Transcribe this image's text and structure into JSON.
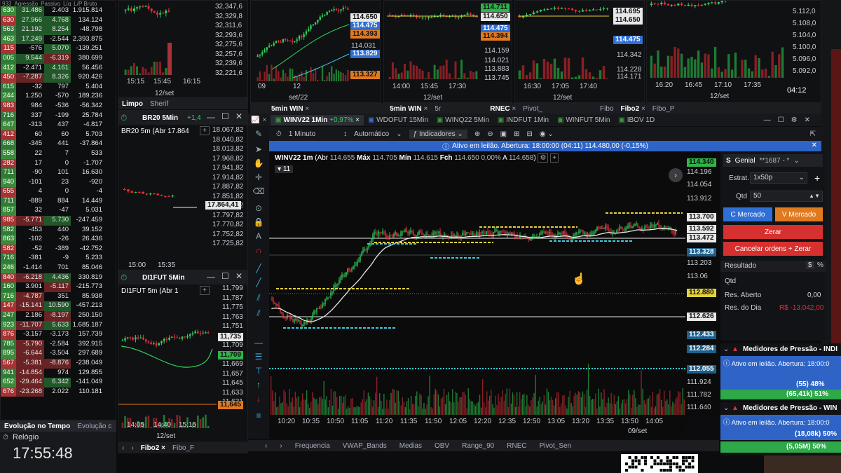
{
  "left_grid": {
    "header": [
      "933",
      "Agressão",
      "Passivo",
      "Líq",
      "L/P Bruto"
    ],
    "rows": [
      [
        "630",
        "31.486",
        "2.403",
        "1.915.814"
      ],
      [
        "630",
        "27.966",
        "4.768",
        "134.124"
      ],
      [
        "563",
        "21.192",
        "8.254",
        "-48.798"
      ],
      [
        "463",
        "17.249",
        "-2.544",
        "2.393.875"
      ],
      [
        "115",
        "-576",
        "5.070",
        "-139.251"
      ],
      [
        "005",
        "9.544",
        "-6.319",
        "380.699"
      ],
      [
        "412",
        "-2.471",
        "4.161",
        "56.456"
      ],
      [
        "450",
        "-7.287",
        "8.326",
        "920.426"
      ],
      [
        "615",
        "-32",
        "797",
        "5.404"
      ],
      [
        "244",
        "1.250",
        "-570",
        "189.236"
      ],
      [
        "983",
        "984",
        "-536",
        "-56.342"
      ],
      [
        "716",
        "337",
        "-199",
        "25.784"
      ],
      [
        "647",
        "-313",
        "437",
        "-4.817"
      ],
      [
        "412",
        "60",
        "60",
        "5.703"
      ],
      [
        "668",
        "-345",
        "441",
        "-37.864"
      ],
      [
        "558",
        "22",
        "7",
        "533"
      ],
      [
        "282",
        "17",
        "0",
        "-1.707"
      ],
      [
        "711",
        "-90",
        "101",
        "16.630"
      ],
      [
        "940",
        "-101",
        "23",
        "-920"
      ],
      [
        "655",
        "4",
        "0",
        "-4"
      ],
      [
        "711",
        "-889",
        "884",
        "14.449"
      ],
      [
        "857",
        "32",
        "-47",
        "5.031"
      ],
      [
        "985",
        "-5.771",
        "5.730",
        "-247.459"
      ],
      [
        "582",
        "-453",
        "440",
        "39.152"
      ],
      [
        "863",
        "-102",
        "-26",
        "26.436"
      ],
      [
        "582",
        "-52",
        "-389",
        "-42.752"
      ],
      [
        "716",
        "-381",
        "-9",
        "5.233"
      ],
      [
        "246",
        "-1.414",
        "701",
        "85.046"
      ],
      [
        "840",
        "-6.218",
        "4.436",
        "330.819"
      ],
      [
        "160",
        "3.901",
        "-5.117",
        "-215.773"
      ],
      [
        "716",
        "-4.787",
        "351",
        "85.938"
      ],
      [
        "147",
        "-15.141",
        "10.590",
        "-457.213"
      ],
      [
        "247",
        "2.186",
        "-8.197",
        "250.150"
      ],
      [
        "923",
        "-11.707",
        "5.633",
        "1.685.187"
      ],
      [
        "876",
        "-3.157",
        "-3.173",
        "157.739"
      ],
      [
        "785",
        "-5.790",
        "-2.584",
        "392.915"
      ],
      [
        "895",
        "-6.644",
        "-3.504",
        "297.689"
      ],
      [
        "567",
        "-5.381",
        "-8.876",
        "-238.049"
      ],
      [
        "941",
        "-14.854",
        "974",
        "129.855"
      ],
      [
        "652",
        "-29.464",
        "6.342",
        "-141.049"
      ],
      [
        "676",
        "-23.268",
        "2.022",
        "110.181"
      ]
    ],
    "bottom_tabs": [
      "Evolução no Tempo",
      "Evolução c"
    ],
    "clock_label": "Relógio",
    "clock_time": "17:55:48"
  },
  "top_charts": {
    "c1": {
      "prices": [
        "32,347,6",
        "32,329,8",
        "32,311,6",
        "32,293,6",
        "32,275,6",
        "32,257,6",
        "32,239,6",
        "32,221,6"
      ],
      "times": [
        "15:15",
        "15:45",
        "16:15"
      ],
      "date": "12/set"
    },
    "c2": {
      "times": [
        "09",
        "12"
      ],
      "date": "set/22",
      "labels": [
        "114.650",
        "114.475",
        "114.393",
        "114.031",
        "113.829",
        "113.327"
      ]
    },
    "c3": {
      "times": [
        "14:00",
        "15:45",
        "17:30"
      ],
      "date": "12/set",
      "labels": [
        "114.711",
        "114.650",
        "114.475",
        "114.394",
        "114.159",
        "114.021",
        "113.883",
        "113.745"
      ]
    },
    "c4": {
      "times": [
        "16:30",
        "17:05",
        "17:40"
      ],
      "date": "12/set",
      "labels": [
        "114.695",
        "114.650",
        "114.475",
        "114.342",
        "114.228",
        "114.171"
      ]
    },
    "c5": {
      "times": [
        "16:20",
        "16:45",
        "17:10",
        "17:35"
      ],
      "date": "12/set",
      "prices": [
        "5.112,0",
        "5.108,0",
        "5.104,0",
        "5.100,0",
        "5.096,0",
        "5.092,0"
      ],
      "clock": "04:12"
    }
  },
  "top_tabbar": {
    "items": [
      "5min WIN",
      "5min WIN",
      "5r",
      "RNEC",
      "Pivot_",
      "Fibo",
      "Fibo2",
      "Fibo_P"
    ]
  },
  "br20": {
    "tabs": [
      "Limpo",
      "Sherif"
    ],
    "title": "BR20 5Min",
    "change": "+1,4",
    "header": "BR20 5m (Abr 17.864",
    "last": "17.864,41",
    "prices": [
      "18.067,82",
      "18.040,82",
      "18.013,82",
      "17.968,82",
      "17.941,82",
      "17.914,82",
      "17.887,82",
      "17.851,82",
      "17.824,82",
      "17.797,82",
      "17.770,82",
      "17.752,82",
      "17.725,82"
    ],
    "times": [
      "15:00",
      "15:35"
    ]
  },
  "di1": {
    "title": "DI1FUT 5Min",
    "header": "DI1FUT 5m (Abr 1",
    "prices": [
      "11,799",
      "11,787",
      "11,775",
      "11,763",
      "11,751",
      "11,735",
      "11,709",
      "11,681",
      "11,669",
      "11,657",
      "11,645",
      "11,633",
      "11,631"
    ],
    "last1": "11,735",
    "last2": "11,709",
    "last3": "11,645",
    "times": [
      "14:05",
      "14:40",
      "15:15"
    ],
    "date": "12/set",
    "tabs": [
      "Fibo2",
      "Fibo_F"
    ]
  },
  "main_tabs": {
    "items": [
      {
        "label": "WINV22 1Min",
        "change": "+0,97%"
      },
      {
        "label": "WDOFUT 15Min"
      },
      {
        "label": "WINQ22 5Min"
      },
      {
        "label": "INDFUT 1Min"
      },
      {
        "label": "WINFUT 5Min"
      },
      {
        "label": "IBOV 1D"
      }
    ]
  },
  "main_toolbar": {
    "interval": "1 Minuto",
    "mode": "Automático",
    "indicators": "Indicadores"
  },
  "auction_banner": "Ativo em leilão. Abertura: 18:00:00 (04:11)  114.480,00 (-0,15%)",
  "main_chart": {
    "header": {
      "symbol": "WINV22 1m",
      "abr_label": "Abr",
      "abr": "114.655",
      "max_label": "Máx",
      "max": "114.705",
      "min_label": "Mín",
      "min": "114.615",
      "fch_label": "Fch",
      "fch": "114.650",
      "chg": "0,00%",
      "a_label": "A",
      "a": "114.658"
    },
    "count": "11",
    "axis": [
      "114.340",
      "114.196",
      "114.054",
      "113.912",
      "113.700",
      "113.592",
      "113.472",
      "113.328",
      "113.203",
      "113.06",
      "112.880",
      "112.626",
      "112.433",
      "112.284",
      "112.055",
      "111.924",
      "111.782",
      "111.640"
    ],
    "times": [
      "10:20",
      "10:35",
      "10:50",
      "11:05",
      "11:20",
      "11:35",
      "11:50",
      "12:05",
      "12:20",
      "12:35",
      "12:50",
      "13:05",
      "13:20",
      "13:35",
      "13:50",
      "14:05"
    ],
    "date": "09/set",
    "colors": {
      "up": "#2fd15a",
      "down": "#e0323c",
      "vwap": "#e8e8e8",
      "cyan": "#36cfe0",
      "yellow": "#e3d13b",
      "green_box": "#2fb34a",
      "blue_box": "#2f6fd6",
      "orange_box": "#e07a1f"
    }
  },
  "bottom_tabs": [
    "Frequencia",
    "VWAP_Bands",
    "Medias",
    "OBV",
    "Range_90",
    "RNEC",
    "Pivot_Sen"
  ],
  "order_panel": {
    "broker": "Genial",
    "account": "**1687 - *",
    "estrat_label": "Estrat.",
    "estrat": "1x50p",
    "qtd_label": "Qtd",
    "qtd": "50",
    "buy": "C Mercado",
    "sell": "V Mercado",
    "zerar": "Zerar",
    "cancel": "Cancelar ordens + Zerar",
    "result_label": "Resultado",
    "rows": [
      {
        "label": "Qtd",
        "value": ""
      },
      {
        "label": "Res. Aberto",
        "value": "0,00"
      },
      {
        "label": "Res. do Dia",
        "value": "R$ -13.042,00"
      }
    ]
  },
  "pressure": [
    {
      "title": "Medidores de Pressão - INDI",
      "banner": "Ativo em leilão. Abertura: 18:00:0",
      "top": "(55) 48%",
      "bottom": "(65,41k) 51%"
    },
    {
      "title": "Medidores de Pressão - WIN",
      "banner": "Ativo em leilão. Abertura: 18:00:0",
      "top": "(18,08k) 50%",
      "bottom": "(5,05M) 50%"
    }
  ]
}
